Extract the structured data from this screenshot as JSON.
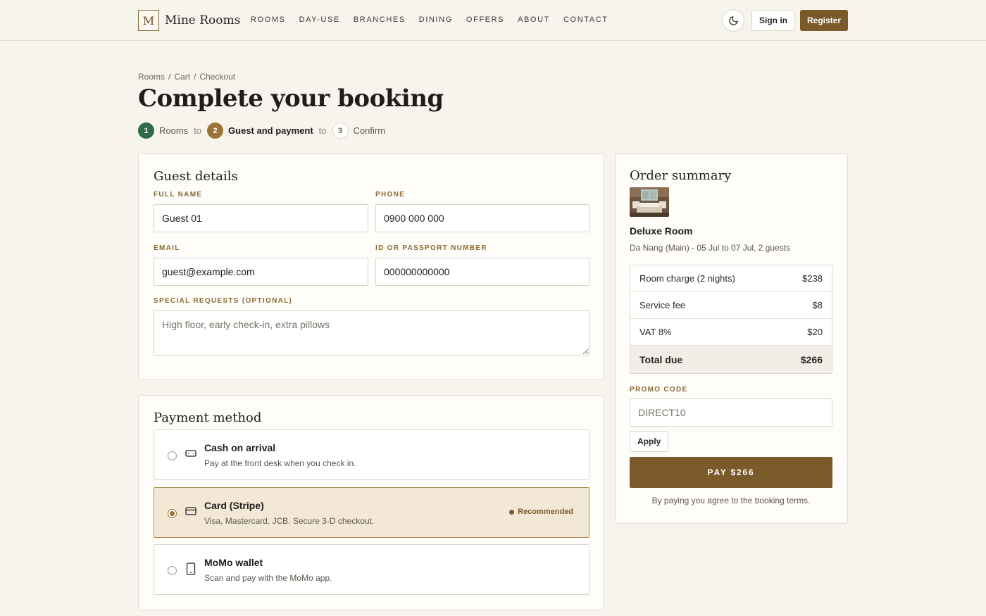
{
  "header": {
    "brand_mark": "M",
    "brand_name": "Mine Rooms",
    "nav": [
      "ROOMS",
      "DAY-USE",
      "BRANCHES",
      "DINING",
      "OFFERS",
      "ABOUT",
      "CONTACT"
    ],
    "sign_in": "Sign in",
    "register": "Register"
  },
  "breadcrumb": [
    "Rooms",
    "Cart",
    "Checkout"
  ],
  "page_title": "Complete your booking",
  "steps": {
    "connector": "to",
    "items": [
      {
        "num": "1",
        "label": "Rooms"
      },
      {
        "num": "2",
        "label": "Guest and payment"
      },
      {
        "num": "3",
        "label": "Confirm"
      }
    ]
  },
  "guest": {
    "title": "Guest details",
    "full_name_label": "FULL NAME",
    "full_name_value": "Guest 01",
    "phone_label": "PHONE",
    "phone_value": "0900 000 000",
    "email_label": "EMAIL",
    "email_value": "guest@example.com",
    "id_label": "ID OR PASSPORT NUMBER",
    "id_value": "000000000000",
    "requests_label": "SPECIAL REQUESTS (OPTIONAL)",
    "requests_placeholder": "High floor, early check-in, extra pillows"
  },
  "payment": {
    "title": "Payment method",
    "options": [
      {
        "name": "Cash on arrival",
        "desc": "Pay at the front desk when you check in.",
        "icon": "cash-icon"
      },
      {
        "name": "Card (Stripe)",
        "desc": "Visa, Mastercard, JCB. Secure 3-D checkout.",
        "icon": "card-icon",
        "badge": "Recommended"
      },
      {
        "name": "MoMo wallet",
        "desc": "Scan and pay with the MoMo app.",
        "icon": "phone-icon"
      }
    ],
    "selected": 1
  },
  "summary": {
    "title": "Order summary",
    "room_name": "Deluxe Room",
    "room_meta": "Da Nang (Main) - 05 Jul to 07 Jul, 2 guests",
    "charges": [
      {
        "label": "Room charge (2 nights)",
        "amount": "$238"
      },
      {
        "label": "Service fee",
        "amount": "$8"
      },
      {
        "label": "VAT 8%",
        "amount": "$20"
      }
    ],
    "total_label": "Total due",
    "total_amount": "$266",
    "promo_label": "PROMO CODE",
    "promo_placeholder": "DIRECT10",
    "apply": "Apply",
    "pay_button": "PAY $266",
    "terms": "By paying you agree to the booking terms."
  },
  "colors": {
    "accent": "#7a5a2a",
    "step_done": "#2f6b47",
    "step_active": "#9a7335",
    "background": "#f7f4ee"
  }
}
